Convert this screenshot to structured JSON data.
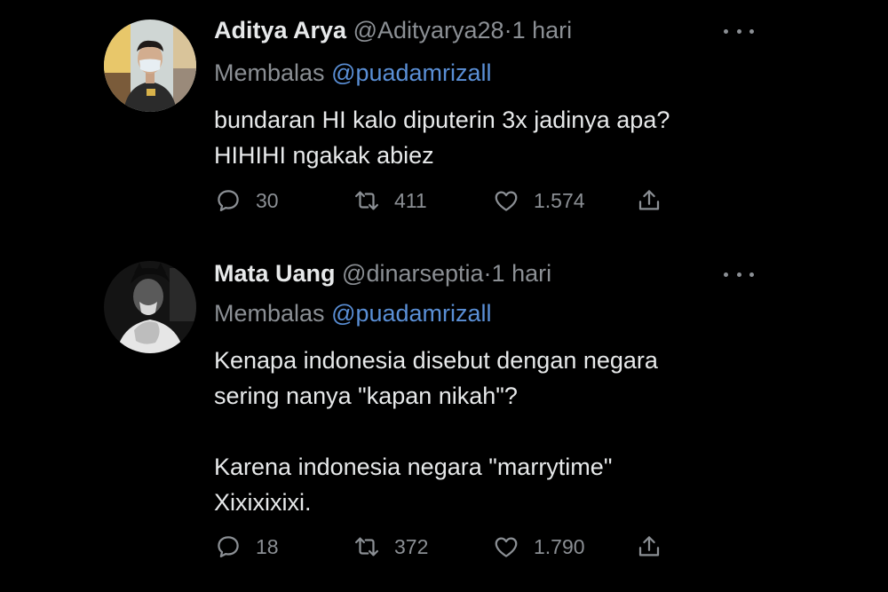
{
  "tweets": [
    {
      "name": "Aditya Arya",
      "handle": "@Adityarya28",
      "dot": "·",
      "time": "1 hari",
      "reply_label": "Membalas",
      "reply_to": "@puadamrizall",
      "lines": [
        "bundaran HI kalo diputerin 3x jadinya apa?",
        "HIHIHI ngakak abiez"
      ],
      "replies": "30",
      "retweets": "411",
      "likes": "1.574"
    },
    {
      "name": "Mata Uang",
      "handle": "@dinarseptia",
      "dot": "·",
      "time": "1 hari",
      "reply_label": "Membalas",
      "reply_to": "@puadamrizall",
      "lines": [
        "Kenapa indonesia disebut dengan negara",
        "sering nanya \"kapan nikah\"?",
        "",
        "Karena indonesia negara \"marrytime\"",
        "Xixixixixi."
      ],
      "replies": "18",
      "retweets": "372",
      "likes": "1.790"
    }
  ],
  "icons": {
    "reply": "speech-bubble-icon",
    "retweet": "retweet-icon",
    "like": "heart-icon",
    "share": "share-icon",
    "more": "more-dots-icon"
  },
  "colors": {
    "background": "#000000",
    "text": "#e7e9ea",
    "muted": "#8b8f94",
    "mention": "#5a8fd6"
  }
}
